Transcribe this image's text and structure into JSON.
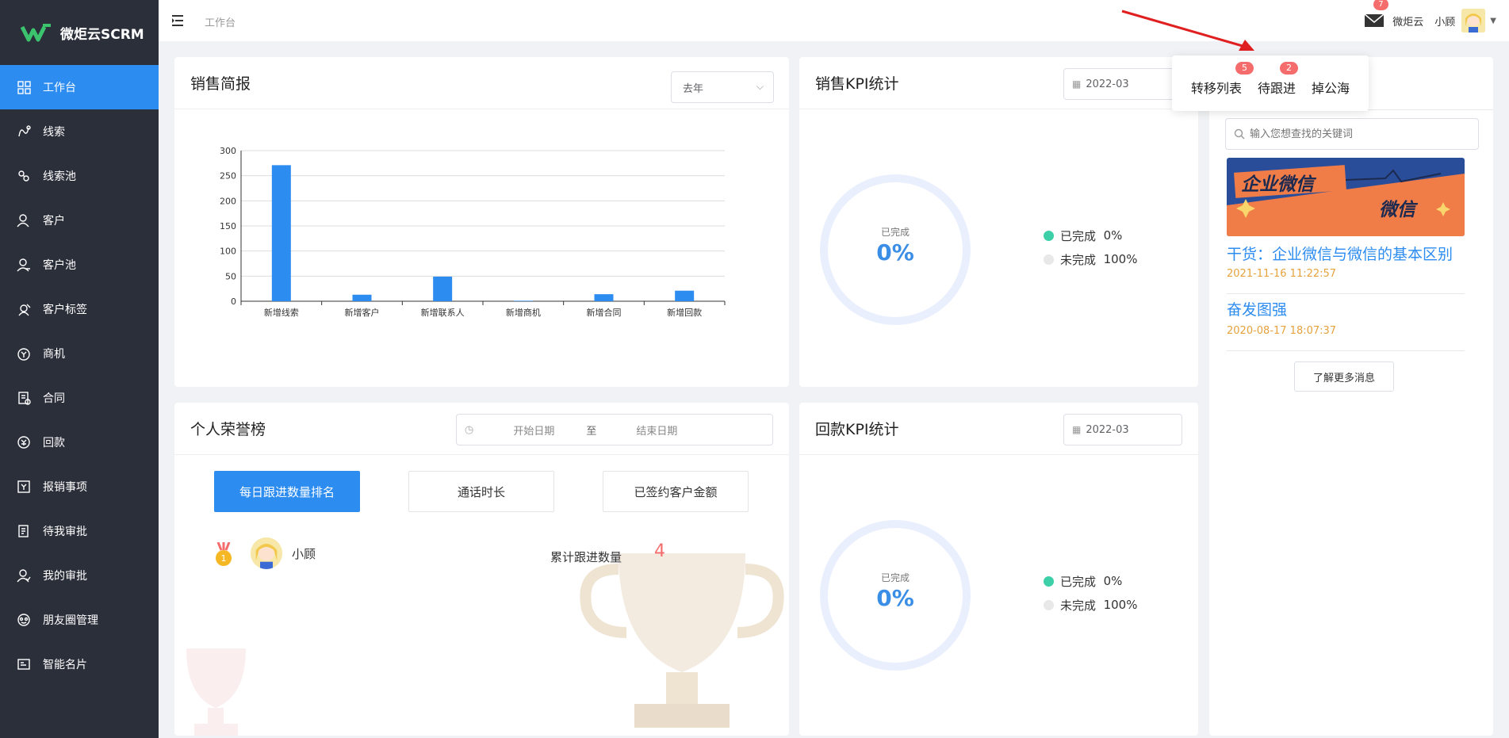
{
  "brand": {
    "name": "微炬云SCRM"
  },
  "sidebar": {
    "items": [
      {
        "label": "工作台",
        "icon": "dashboard-icon"
      },
      {
        "label": "线索",
        "icon": "clue-icon"
      },
      {
        "label": "线索池",
        "icon": "clue-pool-icon"
      },
      {
        "label": "客户",
        "icon": "customer-icon"
      },
      {
        "label": "客户池",
        "icon": "customer-pool-icon"
      },
      {
        "label": "客户标签",
        "icon": "tag-icon"
      },
      {
        "label": "商机",
        "icon": "opportunity-icon"
      },
      {
        "label": "合同",
        "icon": "contract-icon"
      },
      {
        "label": "回款",
        "icon": "payment-icon"
      },
      {
        "label": "报销事项",
        "icon": "reimburse-icon"
      },
      {
        "label": "待我审批",
        "icon": "pending-approval-icon"
      },
      {
        "label": "我的审批",
        "icon": "my-approval-icon"
      },
      {
        "label": "朋友圈管理",
        "icon": "moments-icon"
      },
      {
        "label": "智能名片",
        "icon": "card-icon"
      }
    ]
  },
  "header": {
    "breadcrumb": "工作台",
    "mail_badge": "7",
    "org_name": "微炬云",
    "user_name": "小顾"
  },
  "popover": {
    "items": [
      {
        "label": "转移列表",
        "badge": "5"
      },
      {
        "label": "待跟进",
        "badge": "2"
      },
      {
        "label": "掉公海",
        "badge": ""
      }
    ]
  },
  "sales": {
    "title": "销售简报",
    "period": "去年"
  },
  "chart_data": {
    "type": "bar",
    "categories": [
      "新增线索",
      "新增客户",
      "新增联系人",
      "新增商机",
      "新增合同",
      "新增回款"
    ],
    "values": [
      271,
      13,
      49,
      1,
      14,
      21
    ],
    "ylim": [
      0,
      300
    ],
    "yticks": [
      0,
      50,
      100,
      150,
      200,
      250,
      300
    ],
    "grid": true,
    "color": "#2d8cf0"
  },
  "kpi_sales": {
    "title": "销售KPI统计",
    "date": "2022-03",
    "ring_label": "已完成",
    "ring_value": "0%",
    "legend": [
      {
        "label": "已完成",
        "value": "0%",
        "color": "#3ccfa8"
      },
      {
        "label": "未完成",
        "value": "100%",
        "color": "#e8e8e8"
      }
    ]
  },
  "kpi_payment": {
    "title": "回款KPI统计",
    "date": "2022-03",
    "ring_label": "已完成",
    "ring_value": "0%",
    "legend": [
      {
        "label": "已完成",
        "value": "0%",
        "color": "#3ccfa8"
      },
      {
        "label": "未完成",
        "value": "100%",
        "color": "#e8e8e8"
      }
    ]
  },
  "honor": {
    "title": "个人荣誉榜",
    "start_placeholder": "开始日期",
    "to": "至",
    "end_placeholder": "结束日期",
    "tabs": [
      "每日跟进数量排名",
      "通话时长",
      "已签约客户金额"
    ],
    "rank_list": [
      {
        "rank": "1",
        "name": "小顾",
        "metric_label": "累计跟进数量",
        "value": "4"
      }
    ]
  },
  "news": {
    "search_placeholder": "输入您想查找的关键词",
    "banner_text_1": "企业微信",
    "banner_text_2": "微信",
    "items": [
      {
        "title": "干货：企业微信与微信的基本区别",
        "date": "2021-11-16 11:22:57"
      },
      {
        "title": "奋发图强",
        "date": "2020-08-17 18:07:37"
      }
    ],
    "more_label": "了解更多消息"
  }
}
